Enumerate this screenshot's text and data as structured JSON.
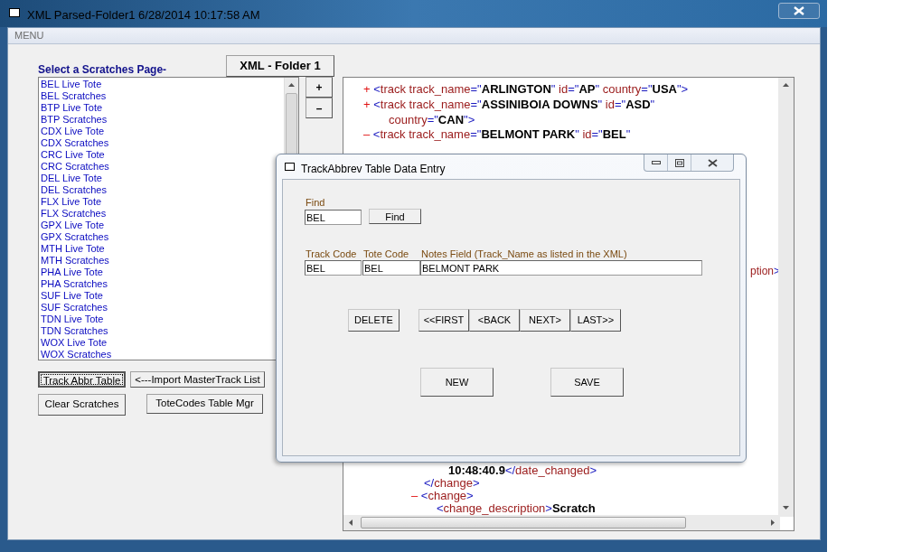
{
  "window": {
    "title": "XML Parsed-Folder1 6/28/2014 10:17:58 AM"
  },
  "menu": [
    "MENU"
  ],
  "scratches": {
    "heading": "Select a Scratches Page-",
    "folder_button": "XML - Folder 1",
    "items": [
      "BEL Live Tote",
      "BEL Scratches",
      "BTP Live Tote",
      "BTP Scratches",
      "CDX Live Tote",
      "CDX Scratches",
      "CRC Live Tote",
      "CRC Scratches",
      "DEL Live Tote",
      "DEL Scratches",
      "FLX Live Tote",
      "FLX Scratches",
      "GPX Live Tote",
      "GPX Scratches",
      "MTH Live Tote",
      "MTH Scratches",
      "PHA Live Tote",
      "PHA Scratches",
      "SUF Live Tote",
      "SUF Scratches",
      "TDN Live Tote",
      "TDN Scratches",
      "WOX Live Tote",
      "WOX Scratches"
    ],
    "zoom_buttons": [
      "+",
      "–"
    ]
  },
  "buttons": [
    {
      "label": "Track Abbr Table",
      "focused": true
    },
    {
      "label": "<---Import MasterTrack List",
      "focused": false
    },
    {
      "label": "Clear Scratches",
      "focused": false
    },
    {
      "label": "ToteCodes Table Mgr",
      "focused": false
    }
  ],
  "xml": {
    "lines": [
      {
        "parts": [
          {
            "kind": "marker",
            "text": "+"
          },
          {
            "kind": "punct",
            "text": " <"
          },
          {
            "kind": "name",
            "text": "track"
          },
          {
            "kind": "attr",
            "text": " track_name"
          },
          {
            "kind": "punct",
            "text": "=\""
          },
          {
            "kind": "value",
            "text": "ARLINGTON"
          },
          {
            "kind": "punct",
            "text": "\""
          },
          {
            "kind": "attr",
            "text": " id"
          },
          {
            "kind": "punct",
            "text": "=\""
          },
          {
            "kind": "value",
            "text": "AP"
          },
          {
            "kind": "punct",
            "text": "\""
          },
          {
            "kind": "attr",
            "text": " country"
          },
          {
            "kind": "punct",
            "text": "=\""
          },
          {
            "kind": "value",
            "text": "USA"
          },
          {
            "kind": "punct",
            "text": "\">"
          }
        ]
      },
      {
        "parts": [
          {
            "kind": "marker",
            "text": "+"
          },
          {
            "kind": "punct",
            "text": " <"
          },
          {
            "kind": "name",
            "text": "track"
          },
          {
            "kind": "attr",
            "text": " track_name"
          },
          {
            "kind": "punct",
            "text": "=\""
          },
          {
            "kind": "value",
            "text": "ASSINIBOIA DOWNS"
          },
          {
            "kind": "punct",
            "text": "\""
          },
          {
            "kind": "attr",
            "text": " id"
          },
          {
            "kind": "punct",
            "text": "=\""
          },
          {
            "kind": "value",
            "text": "ASD"
          },
          {
            "kind": "punct",
            "text": "\""
          }
        ]
      },
      {
        "parts": [
          {
            "kind": "attr",
            "text": "country"
          },
          {
            "kind": "punct",
            "text": "=\""
          },
          {
            "kind": "value",
            "text": "CAN"
          },
          {
            "kind": "punct",
            "text": "\">"
          }
        ]
      },
      {
        "parts": [
          {
            "kind": "marker",
            "text": "–"
          },
          {
            "kind": "punct",
            "text": " <"
          },
          {
            "kind": "name",
            "text": "track"
          },
          {
            "kind": "attr",
            "text": " track_name"
          },
          {
            "kind": "punct",
            "text": "=\""
          },
          {
            "kind": "value",
            "text": "BELMONT PARK"
          },
          {
            "kind": "punct",
            "text": "\""
          },
          {
            "kind": "attr",
            "text": " id"
          },
          {
            "kind": "punct",
            "text": "=\""
          },
          {
            "kind": "value",
            "text": "BEL"
          },
          {
            "kind": "punct",
            "text": "\""
          }
        ]
      },
      {
        "parts": [
          {
            "kind": "name",
            "text": "ption"
          },
          {
            "kind": "punct",
            "text": ">"
          }
        ]
      },
      {
        "parts": [
          {
            "kind": "value",
            "text": "10:48:40.9"
          },
          {
            "kind": "punct",
            "text": "</"
          },
          {
            "kind": "name",
            "text": "date_changed"
          },
          {
            "kind": "punct",
            "text": ">"
          }
        ]
      },
      {
        "parts": [
          {
            "kind": "punct",
            "text": "</"
          },
          {
            "kind": "name",
            "text": "change"
          },
          {
            "kind": "punct",
            "text": ">"
          }
        ]
      },
      {
        "parts": [
          {
            "kind": "marker",
            "text": "–"
          },
          {
            "kind": "punct",
            "text": " <"
          },
          {
            "kind": "name",
            "text": "change"
          },
          {
            "kind": "punct",
            "text": ">"
          }
        ]
      },
      {
        "parts": [
          {
            "kind": "punct",
            "text": "<"
          },
          {
            "kind": "name",
            "text": "change_description"
          },
          {
            "kind": "punct",
            "text": ">"
          },
          {
            "kind": "value",
            "text": "Scratch"
          }
        ]
      }
    ]
  },
  "dialog": {
    "title": "TrackAbbrev Table Data Entry",
    "find": {
      "label": "Find",
      "value": "BEL",
      "button": "Find"
    },
    "fields": [
      {
        "label": "Track Code",
        "value": "BEL"
      },
      {
        "label": "Tote Code",
        "value": "BEL"
      },
      {
        "label": "Notes Field (Track_Name as listed in the XML)",
        "value": "BELMONT PARK"
      }
    ],
    "delete_button": "DELETE",
    "nav_buttons": [
      "<<FIRST",
      "<BACK",
      "NEXT>",
      "LAST>>"
    ],
    "action_buttons": [
      "NEW",
      "SAVE"
    ]
  }
}
